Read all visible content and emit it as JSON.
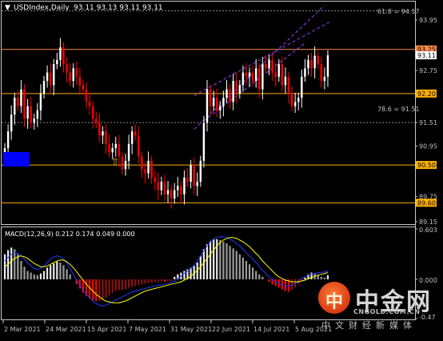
{
  "header": {
    "symbol": "USDIndex,Daily",
    "ohlc": "93.11 93.13 93.11 93.11"
  },
  "colors": {
    "background": "#000000",
    "bull": "#ffffff",
    "bear": "#ff0000",
    "support_line": "#ffb000",
    "grid_text": "#c0c0c0",
    "macd_signal": "#ffff00",
    "macd_line": "#1e3cff",
    "channel": "#9b3cff"
  },
  "chart_data": [
    {
      "type": "candlestick",
      "title": "USDIndex,Daily",
      "ylim": [
        89.13,
        94.35
      ],
      "y_ticks": [
        "93.95",
        "93.25",
        "93.11",
        "92.75",
        "92.20",
        "91.51",
        "90.95",
        "90.50",
        "89.75",
        "89.60",
        "89.15"
      ],
      "x_ticks": [
        "2 Mar 2021",
        "24 Mar 2021",
        "15 Apr 2021",
        "7 May 2021",
        "31 May 2021",
        "22 Jun 2021",
        "14 Jul 2021",
        "5 Aug 2021"
      ],
      "closes": [
        90.9,
        91.3,
        91.7,
        92.1,
        91.9,
        92.3,
        91.6,
        91.9,
        91.5,
        91.6,
        91.8,
        92.2,
        92.5,
        92.7,
        92.4,
        92.9,
        93.0,
        93.3,
        92.9,
        92.7,
        92.5,
        92.8,
        92.6,
        92.4,
        92.3,
        92.0,
        91.9,
        91.6,
        91.5,
        91.2,
        91.3,
        91.0,
        90.8,
        90.9,
        91.0,
        90.7,
        90.4,
        90.6,
        91.0,
        91.3,
        91.2,
        90.7,
        90.4,
        90.3,
        90.6,
        90.2,
        90.1,
        89.9,
        90.1,
        89.8,
        89.9,
        89.7,
        89.9,
        90.0,
        89.8,
        90.2,
        90.1,
        90.5,
        90.0,
        90.1,
        90.6,
        91.5,
        92.3,
        91.9,
        92.1,
        91.8,
        91.9,
        92.1,
        92.3,
        92.0,
        92.5,
        92.2,
        92.4,
        92.7,
        92.6,
        92.7,
        92.5,
        92.8,
        92.3,
        92.9,
        92.8,
        93.0,
        92.7,
        92.6,
        92.9,
        92.4,
        92.6,
        92.2,
        91.9,
        92.0,
        92.1,
        92.6,
        92.8,
        93.0,
        92.8,
        93.1,
        92.9,
        92.5,
        92.6,
        93.11
      ],
      "channel_label": "61.8 = 94.17",
      "fib_label": "78.6 = 91.51",
      "levels": [
        {
          "value": 94.17,
          "label": "",
          "style": "dotted"
        },
        {
          "value": 93.25,
          "label": "93.25",
          "style": "solid"
        },
        {
          "value": 92.2,
          "label": "92.20",
          "style": "solid"
        },
        {
          "value": 91.51,
          "label": "",
          "style": "dotted"
        },
        {
          "value": 90.5,
          "label": "90.50",
          "style": "solid"
        },
        {
          "value": 89.6,
          "label": "89.60",
          "style": "solid"
        }
      ],
      "current_price": "93.11",
      "annotation": {
        "type": "up-arrow",
        "near": "15 Apr 2021"
      }
    },
    {
      "type": "macd",
      "title": "MACD(12,26,9) 0.212 0.174 0.049 0.000",
      "params": "12,26,9",
      "values": [
        0.212,
        0.174,
        0.049,
        0.0
      ],
      "y_ticks": [
        "0.603",
        "0.000",
        "-0.47"
      ],
      "ylim": [
        -0.47,
        0.603
      ],
      "histogram": [
        0.3,
        0.35,
        0.38,
        0.36,
        0.3,
        0.22,
        0.15,
        0.1,
        0.08,
        0.06,
        0.05,
        0.07,
        0.1,
        0.14,
        0.17,
        0.19,
        0.21,
        0.2,
        0.17,
        0.12,
        0.06,
        0.0,
        -0.06,
        -0.11,
        -0.16,
        -0.2,
        -0.23,
        -0.25,
        -0.26,
        -0.26,
        -0.24,
        -0.22,
        -0.19,
        -0.16,
        -0.14,
        -0.13,
        -0.13,
        -0.12,
        -0.1,
        -0.09,
        -0.08,
        -0.07,
        -0.06,
        -0.05,
        -0.04,
        -0.04,
        -0.03,
        -0.03,
        -0.02,
        -0.03,
        -0.02,
        -0.02,
        0.03,
        0.06,
        0.08,
        0.1,
        0.12,
        0.14,
        0.16,
        0.2,
        0.28,
        0.36,
        0.42,
        0.46,
        0.48,
        0.48,
        0.47,
        0.45,
        0.43,
        0.4,
        0.37,
        0.34,
        0.3,
        0.26,
        0.22,
        0.18,
        0.14,
        0.1,
        0.06,
        0.03,
        0.0,
        -0.03,
        -0.06,
        -0.08,
        -0.1,
        -0.12,
        -0.14,
        -0.15,
        -0.13,
        -0.1,
        -0.06,
        -0.02,
        0.02,
        0.06,
        0.08,
        0.07,
        0.05,
        0.03,
        0.02,
        0.05
      ],
      "macd_line": [
        0.22,
        0.26,
        0.3,
        0.32,
        0.31,
        0.28,
        0.24,
        0.2,
        0.16,
        0.13,
        0.12,
        0.13,
        0.16,
        0.2,
        0.24,
        0.27,
        0.28,
        0.27,
        0.24,
        0.19,
        0.13,
        0.06,
        -0.01,
        -0.07,
        -0.13,
        -0.18,
        -0.22,
        -0.26,
        -0.29,
        -0.31,
        -0.32,
        -0.31,
        -0.29,
        -0.27,
        -0.25,
        -0.23,
        -0.21,
        -0.19,
        -0.17,
        -0.15,
        -0.14,
        -0.13,
        -0.12,
        -0.11,
        -0.1,
        -0.09,
        -0.08,
        -0.07,
        -0.07,
        -0.06,
        -0.05,
        -0.04,
        -0.02,
        0.01,
        0.04,
        0.07,
        0.1,
        0.13,
        0.17,
        0.22,
        0.28,
        0.34,
        0.4,
        0.45,
        0.48,
        0.5,
        0.51,
        0.51,
        0.5,
        0.48,
        0.46,
        0.43,
        0.4,
        0.36,
        0.32,
        0.28,
        0.24,
        0.2,
        0.15,
        0.11,
        0.07,
        0.03,
        0.0,
        -0.03,
        -0.05,
        -0.07,
        -0.08,
        -0.08,
        -0.07,
        -0.05,
        -0.02,
        0.01,
        0.03,
        0.05,
        0.06,
        0.07,
        0.08,
        0.08,
        0.09,
        0.1
      ],
      "signal_line": [
        0.15,
        0.18,
        0.22,
        0.25,
        0.27,
        0.28,
        0.27,
        0.25,
        0.22,
        0.19,
        0.17,
        0.15,
        0.15,
        0.16,
        0.18,
        0.2,
        0.22,
        0.23,
        0.23,
        0.21,
        0.18,
        0.14,
        0.09,
        0.04,
        -0.01,
        -0.06,
        -0.1,
        -0.14,
        -0.18,
        -0.21,
        -0.24,
        -0.26,
        -0.27,
        -0.28,
        -0.28,
        -0.28,
        -0.27,
        -0.26,
        -0.24,
        -0.22,
        -0.2,
        -0.18,
        -0.16,
        -0.14,
        -0.13,
        -0.12,
        -0.11,
        -0.1,
        -0.09,
        -0.08,
        -0.07,
        -0.06,
        -0.05,
        -0.04,
        -0.03,
        -0.01,
        0.01,
        0.04,
        0.07,
        0.11,
        0.15,
        0.2,
        0.25,
        0.3,
        0.35,
        0.4,
        0.44,
        0.47,
        0.49,
        0.5,
        0.5,
        0.49,
        0.47,
        0.45,
        0.42,
        0.39,
        0.35,
        0.31,
        0.27,
        0.22,
        0.18,
        0.14,
        0.1,
        0.06,
        0.03,
        0.01,
        -0.01,
        -0.02,
        -0.03,
        -0.03,
        -0.03,
        -0.02,
        -0.01,
        0.01,
        0.02,
        0.04,
        0.05,
        0.06,
        0.07,
        0.08
      ]
    }
  ],
  "watermark": {
    "logo_glyph": "中",
    "brand_cn": "中金网",
    "url": "CNGOLD.COM.CN",
    "slogan": "中文财经新媒体"
  }
}
